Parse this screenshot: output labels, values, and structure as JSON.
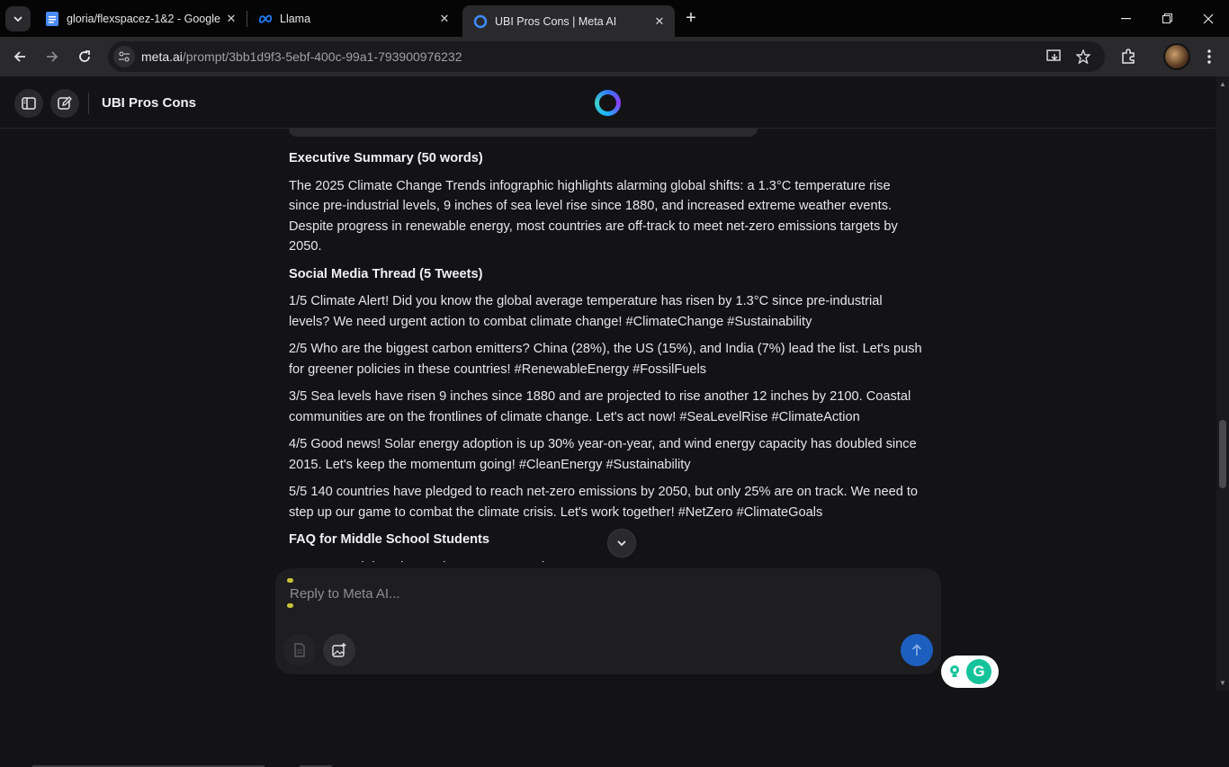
{
  "browser": {
    "tabs": [
      {
        "title": "gloria/flexspacez-1&2 - Google",
        "icon": "google-docs-icon"
      },
      {
        "title": "Llama",
        "icon": "meta-logo-icon"
      },
      {
        "title": "UBI Pros Cons | Meta AI",
        "icon": "meta-ai-icon"
      }
    ],
    "url_host": "meta.ai",
    "url_path": "/prompt/3bb1d9f3-5ebf-400c-99a1-793900976232"
  },
  "header": {
    "title": "UBI Pros Cons"
  },
  "content": {
    "sections": [
      {
        "heading": "Executive Summary (50 words)",
        "paragraphs": [
          "The 2025 Climate Change Trends infographic highlights alarming global shifts: a 1.3°C temperature rise since pre-industrial levels, 9 inches of sea level rise since 1880, and increased extreme weather events. Despite progress in renewable energy, most countries are off-track to meet net-zero emissions targets by 2050."
        ]
      },
      {
        "heading": "Social Media Thread (5 Tweets)",
        "paragraphs": [
          "1/5 Climate Alert! Did you know the global average temperature has risen by 1.3°C since pre-industrial levels? We need urgent action to combat climate change! #ClimateChange #Sustainability",
          "2/5 Who are the biggest carbon emitters? China (28%), the US (15%), and India (7%) lead the list. Let's push for greener policies in these countries! #RenewableEnergy #FossilFuels",
          "3/5 Sea levels have risen 9 inches since 1880 and are projected to rise another 12 inches by 2100. Coastal communities are on the frontlines of climate change. Let's act now! #SeaLevelRise #ClimateAction",
          "4/5 Good news! Solar energy adoption is up 30% year-on-year, and wind energy capacity has doubled since 2015. Let's keep the momentum going! #CleanEnergy #Sustainability",
          "5/5 140 countries have pledged to reach net-zero emissions by 2050, but only 25% are on track. We need to step up our game to combat the climate crisis. Let's work together! #NetZero #ClimateGoals"
        ]
      },
      {
        "heading": "FAQ for Middle School Students",
        "paragraphs": [
          "Q: How much has the Earth's temperature risen?"
        ]
      }
    ]
  },
  "composer": {
    "placeholder": "Reply to Meta AI..."
  },
  "colors": {
    "background": "#131316",
    "send_button": "#1d5fbf",
    "grammarly": "#15c39a"
  }
}
